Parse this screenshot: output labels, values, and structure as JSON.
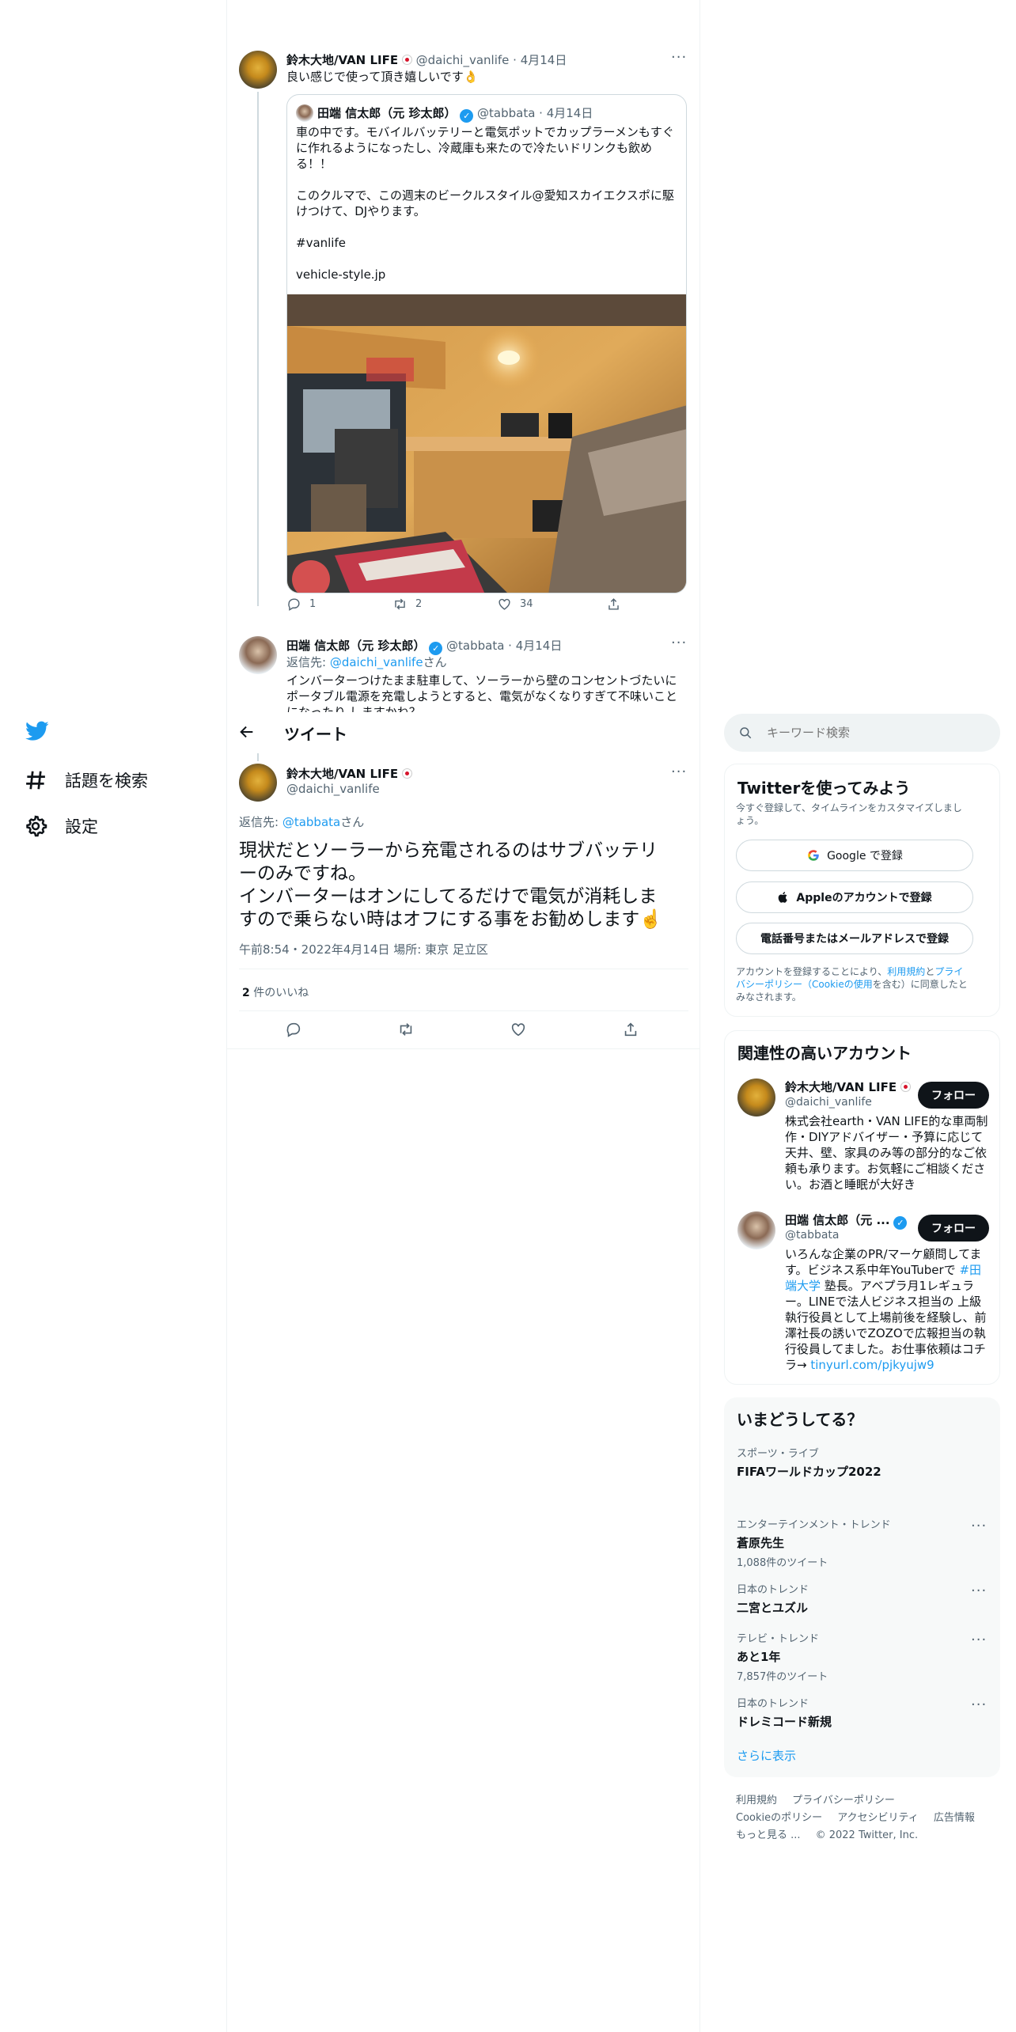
{
  "nav": {
    "explore_label": "話題を検索",
    "settings_label": "設定"
  },
  "header": {
    "title": "ツイート"
  },
  "parent_tweet": {
    "author_name": "鈴木大地/VAN LIFE",
    "handle": "@daichi_vanlife",
    "date": "4月14日",
    "text": "良い感じで使って頂き嬉しいです👌",
    "quote": {
      "author_name": "田端 信太郎（元 珍太郎）",
      "handle": "@tabbata",
      "date": "4月14日",
      "line1": "車の中です。モバイルバッテリーと電気ポットでカップラーメンもすぐ",
      "line2": "に作れるようになったし、冷蔵庫も来たので冷たいドリンクも飲め",
      "line3": "る！！",
      "line4": "このクルマで、この週末のビークルスタイル@愛知スカイエクスポに駆",
      "line5": "けつけて、DJやります。",
      "hashtag": "#vanlife",
      "url": "vehicle-style.jp"
    },
    "reply_count": "1",
    "retweet_count": "2",
    "like_count": "34"
  },
  "reply_tweet": {
    "author_name": "田端 信太郎（元 珍太郎）",
    "handle": "@tabbata",
    "date": "4月14日",
    "reply_to_prefix": "返信先: ",
    "reply_to_handle": "@daichi_vanlife",
    "reply_to_suffix": "さん",
    "line1": "インバーターつけたまま駐車して、ソーラーから壁のコンセントづたいに",
    "line2": "ポータブル電源を充電しようとすると、電気がなくなりすぎて不味いこと",
    "line3": "になったり しますかね？"
  },
  "main_tweet": {
    "author_name": "鈴木大地/VAN LIFE",
    "handle": "@daichi_vanlife",
    "reply_to_prefix": "返信先: ",
    "reply_to_handle": "@tabbata",
    "reply_to_suffix": "さん",
    "line1": "現状だとソーラーから充電されるのはサブバッテリ",
    "line2": "ーのみですね。",
    "line3": "インバーターはオンにしてるだけで電気が消耗しま",
    "line4": "すので乗らない時はオフにする事をお勧めします☝️",
    "meta": "午前8:54・2022年4月14日 場所: 東京 足立区",
    "likes_number": "2",
    "likes_label": " 件のいいね"
  },
  "search": {
    "placeholder": "キーワード検索"
  },
  "signup": {
    "title": "Twitterを使ってみよう",
    "subtitle_line1": "今すぐ登録して、タイムラインをカスタマイズしまし",
    "subtitle_line2": "ょう。",
    "google_label": "Google で登録",
    "apple_label": "Appleのアカウントで登録",
    "phone_label": "電話番号またはメールアドレスで登録",
    "legal_1": "アカウントを登録することにより、",
    "legal_terms": "利用規約",
    "legal_and": "と",
    "legal_privacy": "プライ",
    "legal_privacy2": "バシーポリシー",
    "legal_cookie_open": "（",
    "legal_cookie": "Cookieの使用",
    "legal_2": "を含む）に同意したと",
    "legal_3": "みなされます。"
  },
  "related": {
    "title": "関連性の高いアカウント",
    "follow_label": "フォロー",
    "accounts": [
      {
        "name": "鈴木大地/VAN LIFE",
        "handle": "@daichi_vanlife",
        "bio_lines": [
          "株式会社earth・VAN LIFE的な車両制",
          "作・DIYアドバイザー・予算に応じて",
          "天井、壁、家具のみ等の部分的なご依",
          "頼も承ります。お気軽にご相談くださ",
          "い。お酒と睡眠が大好き"
        ]
      },
      {
        "name": "田端 信太郎（元 ...",
        "handle": "@tabbata",
        "bio_line1": "いろんな企業のPR/マーケ顧問してま",
        "bio_line2a": "す。ビジネス系中年YouTuberで ",
        "bio_tag1": "#田",
        "bio_tag2": "端大学",
        "bio_line3b": " 塾長。アベプラ月1レギュラ",
        "bio_line4": "ー。LINEで法人ビジネス担当の 上級",
        "bio_line5": "執行役員として上場前後を経験し、前",
        "bio_line6": "澤社長の誘いでZOZOで広報担当の執",
        "bio_line7": "行役員してました。お仕事依頼はコチ",
        "bio_line8a": "ラ→ ",
        "bio_link": "tinyurl.com/pjkyujw9"
      }
    ]
  },
  "trends": {
    "title": "いまどうしてる？",
    "items": [
      {
        "category": "スポーツ・ライブ",
        "name": "FIFAワールドカップ2022",
        "count": ""
      },
      {
        "category": "エンターテインメント・トレンド",
        "name": "蒼原先生",
        "count": "1,088件のツイート"
      },
      {
        "category": "日本のトレンド",
        "name": "二宮とユズル",
        "count": ""
      },
      {
        "category": "テレビ・トレンド",
        "name": "あと1年",
        "count": "7,857件のツイート"
      },
      {
        "category": "日本のトレンド",
        "name": "ドレミコード新規",
        "count": ""
      }
    ],
    "show_more": "さらに表示"
  },
  "footer": {
    "terms": "利用規約",
    "privacy": "プライバシーポリシー",
    "cookie": "Cookieのポリシー",
    "accessibility": "アクセシビリティ",
    "ads": "広告情報",
    "more": "もっと見る ...",
    "copyright": "© 2022 Twitter, Inc."
  },
  "colors": {
    "accent": "#1d9bf0",
    "text": "#0f1419",
    "muted": "#536471"
  }
}
